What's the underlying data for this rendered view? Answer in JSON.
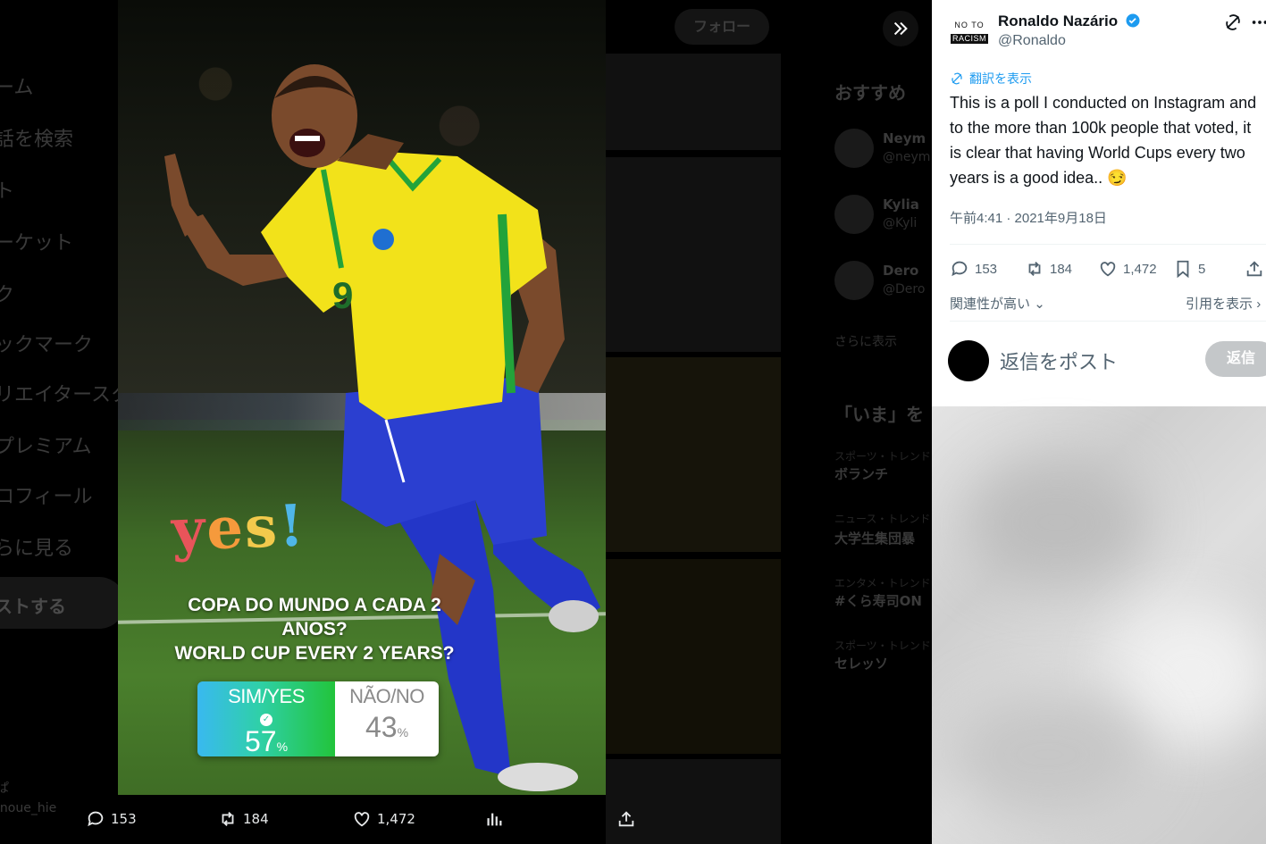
{
  "background": {
    "nav_items": [
      "ーム",
      "話を検索",
      "ト",
      "ーケット",
      "ク",
      "ックマーク",
      "リエイタースタ",
      "プレミアム",
      "ロフィール",
      "らに見る"
    ],
    "post_button": "ストする",
    "account_name": "ぱ",
    "account_handle": "inoue_hie",
    "follow_button": "フォロー",
    "recommend_title": "おすすめ",
    "recommendations": [
      {
        "name": "Neym",
        "handle": "@neym"
      },
      {
        "name": "Kylia",
        "handle": "@Kyli"
      },
      {
        "name": "Dero",
        "handle": "@Dero"
      }
    ],
    "more_label": "さらに表示",
    "trends_title": "「いま」を",
    "trends": [
      {
        "sub": "スポーツ・トレンド",
        "name": "ボランチ"
      },
      {
        "sub": "ニュース・トレンド",
        "name": "大学生集団暴"
      },
      {
        "sub": "エンタメ・トレンド",
        "name": "#くら寿司ON"
      },
      {
        "sub": "スポーツ・トレンド",
        "name": "セレッソ"
      }
    ]
  },
  "media": {
    "sticker_letters": [
      "y",
      "e",
      "s",
      "!"
    ],
    "question_lines": [
      "COPA DO MUNDO A CADA 2",
      "ANOS?",
      "WORLD CUP EVERY 2 YEARS?"
    ],
    "poll": {
      "yes_label": "SIM/YES",
      "yes_percent": "57",
      "no_label": "NÃO/NO",
      "no_percent": "43",
      "percent_sign": "%",
      "check": "✓",
      "yes_share": 0.57
    },
    "actions": {
      "replies": "153",
      "reposts": "184",
      "likes": "1,472"
    }
  },
  "tweet": {
    "author_name": "Ronaldo Nazário",
    "author_handle": "@Ronaldo",
    "avatar_line1": "NO TO",
    "avatar_line2": "RACISM",
    "translate_label": "翻訳を表示",
    "text": "This is a poll I conducted on Instagram and to the more than 100k people that voted, it is clear that having World Cups every two years is a good idea.. 😏",
    "timestamp": "午前4:41 · 2021年9月18日",
    "stats": {
      "replies": "153",
      "reposts": "184",
      "likes": "1,472",
      "bookmarks": "5"
    },
    "sort_label": "関連性が高い",
    "quotes_label": "引用を表示",
    "reply_placeholder": "返信をポスト",
    "reply_button": "返信"
  },
  "colors": {
    "accent": "#1d9bf0",
    "poll_yes_start": "#39b9f0",
    "poll_yes_end": "#22c43b",
    "jersey_yellow": "#f2e21a",
    "shorts_blue": "#2b3fd0"
  }
}
